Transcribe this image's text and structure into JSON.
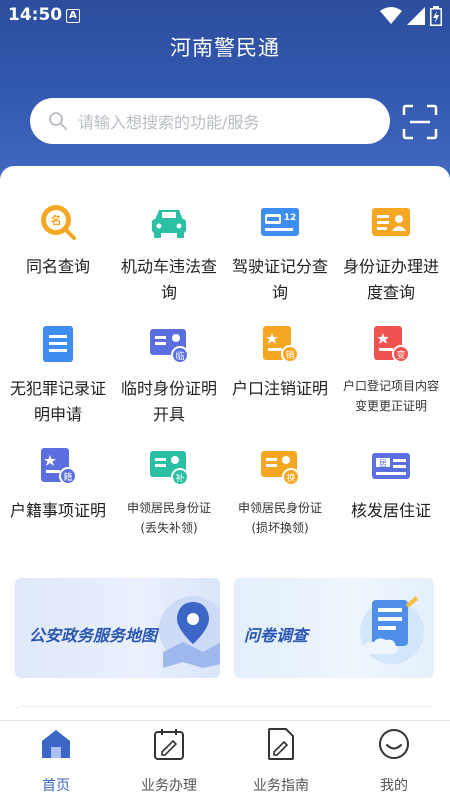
{
  "status_bar": {
    "time": "14:50",
    "a_badge": "A"
  },
  "app": {
    "title": "河南警民通"
  },
  "search": {
    "placeholder": "请输入想搜索的功能/服务"
  },
  "services": [
    {
      "label": "同名查询",
      "icon": "name-query-icon"
    },
    {
      "label": "机动车违法查询",
      "icon": "car-icon"
    },
    {
      "label": "驾驶证记分查询",
      "icon": "license-icon",
      "badge": "12"
    },
    {
      "label": "身份证办理进度查询",
      "icon": "id-card-icon"
    },
    {
      "label": "无犯罪记录证明申请",
      "icon": "document-icon"
    },
    {
      "label": "临时身份证明开具",
      "icon": "temp-id-icon",
      "badge": "临"
    },
    {
      "label": "户口注销证明",
      "icon": "hukou-cancel-icon",
      "badge": "销"
    },
    {
      "label": "户口登记项目内容变更更正证明",
      "icon": "hukou-change-icon",
      "badge": "变"
    },
    {
      "label": "户籍事项证明",
      "icon": "household-icon",
      "badge": "籍"
    },
    {
      "label": "申领居民身份证(丢失补领)",
      "icon": "id-reissue-icon",
      "badge": "补"
    },
    {
      "label": "申领居民身份证(损坏换领)",
      "icon": "id-replace-icon",
      "badge": "换"
    },
    {
      "label": "核发居住证",
      "icon": "residence-permit-icon",
      "badge": "居"
    }
  ],
  "banners": {
    "map": "公安政务服务地图",
    "survey": "问卷调查"
  },
  "tabs": [
    {
      "label": "首页",
      "icon": "home-icon"
    },
    {
      "label": "业务办理",
      "icon": "calendar-icon"
    },
    {
      "label": "业务指南",
      "icon": "guide-icon"
    },
    {
      "label": "我的",
      "icon": "smile-icon"
    }
  ],
  "colors": {
    "header": "#3358b0",
    "accent": "#3c67c6",
    "orange": "#f5a623",
    "teal": "#2bbfa4",
    "blue": "#3d8ef0",
    "red": "#f0524f"
  }
}
